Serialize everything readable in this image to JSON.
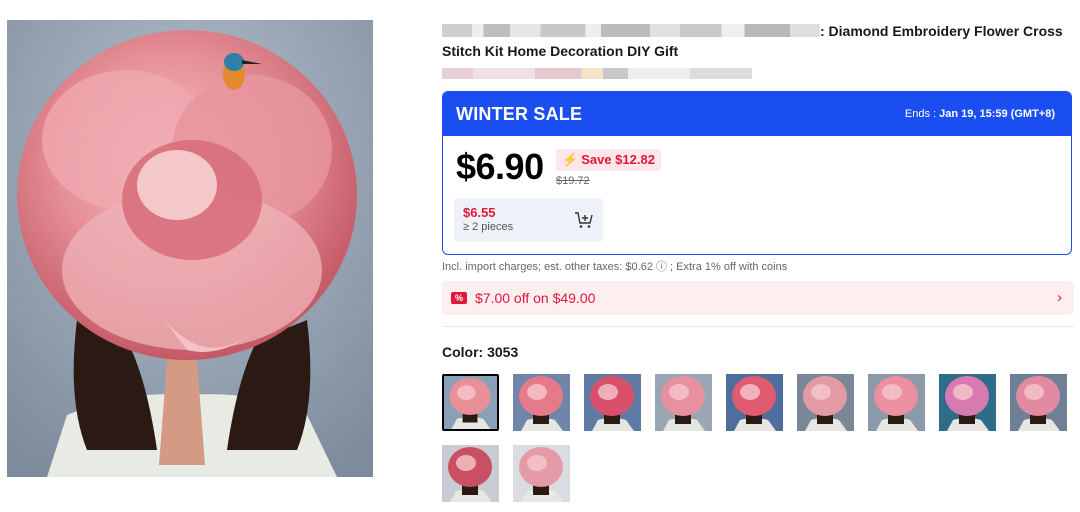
{
  "product": {
    "title_blurred_prefix": "",
    "title": ": Diamond Embroidery Flower Cross Stitch Kit Home Decoration DIY Gift"
  },
  "sale": {
    "title": "WINTER SALE",
    "ends_label": "Ends :",
    "ends_value": "Jan 19, 15:59 (GMT+8)",
    "price": "$6.90",
    "save": "Save $12.82",
    "original_price": "$19.72",
    "tier_price": "$6.55",
    "tier_qty": "≥ 2 pieces"
  },
  "tax_note": "Incl. import charges; est. other taxes: $0.62 ⓘ ; Extra 1% off with coins",
  "coupon": {
    "text": "$7.00 off on $49.00",
    "icon": "coupon-icon"
  },
  "color": {
    "label": "Color: 3053",
    "swatch_count": 11,
    "selected_index": 0
  },
  "colors": {
    "accent": "#1a4ef0",
    "sale_red": "#e0183c",
    "coupon_bg": "#fdeff0"
  }
}
